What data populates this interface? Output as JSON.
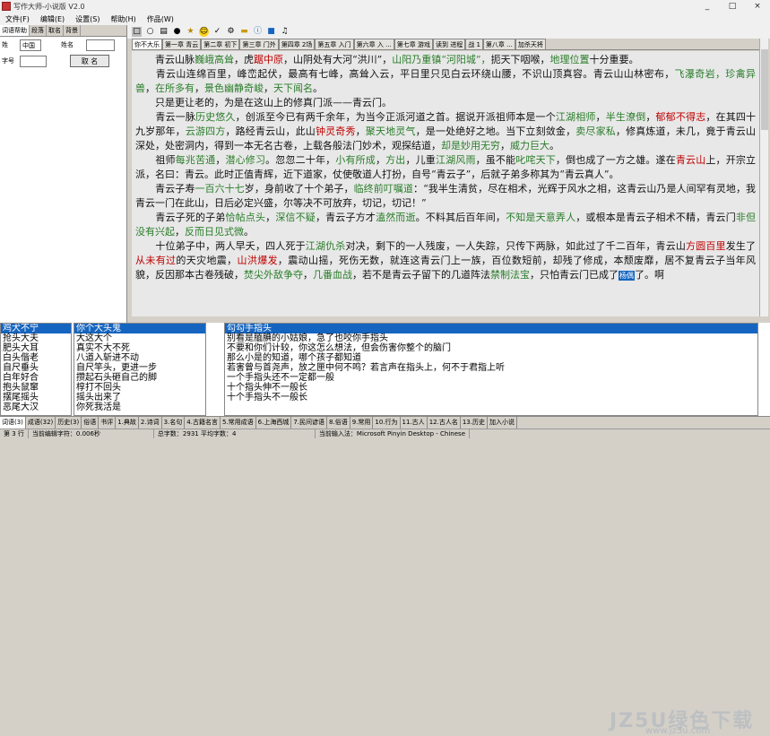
{
  "window": {
    "title": "写作大师-小说版 V2.0",
    "controls": [
      "_",
      "□",
      "×"
    ]
  },
  "menu": [
    "文件(F)",
    "编辑(E)",
    "设置(S)",
    "帮助(H)",
    "作品(W)"
  ],
  "left_panel": {
    "tabs": [
      "词语帮助",
      "段落",
      "取名",
      "背景"
    ],
    "row1": {
      "label": "姓",
      "field1": "中国",
      "label2": "姓名",
      "field2": ""
    },
    "row2": {
      "label": "字号",
      "field": "",
      "button": "取 名"
    }
  },
  "toolbar_icons": [
    "new-icon",
    "open-icon",
    "save-icon",
    "find-icon",
    "star-icon",
    "smile-icon",
    "check-icon",
    "settings-icon",
    "folder-icon",
    "info-icon",
    "stop-icon",
    "sound-icon"
  ],
  "doc_tabs": [
    "你不大乐",
    "第一章 青云",
    "第二章 初下",
    "第三章 门外",
    "第四章 2场",
    "第五章 入门",
    "第六章 入 ...",
    "第七章 游戏",
    "读到 进程",
    "战 1",
    "第八章 ...",
    "加杀天将"
  ],
  "paragraphs": [
    [
      {
        "t": "　　青云山脉"
      },
      {
        "t": "巍峨高耸",
        "c": "g"
      },
      {
        "t": "，虎"
      },
      {
        "t": "踞中原",
        "c": "r"
      },
      {
        "t": "，山阴处有大河“洪川”，"
      },
      {
        "t": "山阳乃重镇“河阳城”，",
        "c": "g"
      },
      {
        "t": "扼天下咽喉，"
      },
      {
        "t": "地理位置",
        "c": "g"
      },
      {
        "t": "十分重要。"
      }
    ],
    [
      {
        "t": "　　青云山连绵百里，峰峦起伏，最高有七峰，高耸入云，平日里只见白云环绕山腰，不识山顶真容。青云山山林密布，"
      },
      {
        "t": "飞瀑奇岩，珍禽异兽",
        "c": "g"
      },
      {
        "t": "，"
      },
      {
        "t": "在所多有",
        "c": "g"
      },
      {
        "t": "，"
      },
      {
        "t": "景色幽静奇峻",
        "c": "g"
      },
      {
        "t": "，"
      },
      {
        "t": "天下闻名",
        "c": "g"
      },
      {
        "t": "。"
      }
    ],
    [
      {
        "t": "　　只是更让老的，为是在这山上的修真门派——青云门。"
      }
    ],
    [
      {
        "t": "　　青云一脉"
      },
      {
        "t": "历史悠久",
        "c": "g"
      },
      {
        "t": "，创派至今已有两千余年，为当今正派河道之首。据说开派祖师本是一个"
      },
      {
        "t": "江湖相师",
        "c": "g"
      },
      {
        "t": "，"
      },
      {
        "t": "半生潦倒",
        "c": "g"
      },
      {
        "t": "，"
      },
      {
        "t": "郁郁不得志",
        "c": "r"
      },
      {
        "t": "，在其四十九岁那年，"
      },
      {
        "t": "云游四方",
        "c": "g"
      },
      {
        "t": "，路经青云山，此山"
      },
      {
        "t": "钟灵奇秀",
        "c": "r"
      },
      {
        "t": "，"
      },
      {
        "t": "聚天地灵气",
        "c": "g"
      },
      {
        "t": "，是一处绝好之地。当下立刻敛金，"
      },
      {
        "t": "卖尽家私",
        "c": "g"
      },
      {
        "t": "，修真炼道，未几，竟于青云山深处，处密洞内，得到一本无名古卷，上载各般法门妙术，观探结道，"
      },
      {
        "t": "却是妙用无穷",
        "c": "g"
      },
      {
        "t": "，"
      },
      {
        "t": "威力巨大",
        "c": "g"
      },
      {
        "t": "。"
      }
    ],
    [
      {
        "t": "　　祖师"
      },
      {
        "t": "每兆苦通",
        "c": "g"
      },
      {
        "t": "，"
      },
      {
        "t": "潜心修习",
        "c": "g"
      },
      {
        "t": "。忽忽二十年，"
      },
      {
        "t": "小有所成",
        "c": "g"
      },
      {
        "t": "，"
      },
      {
        "t": "方出",
        "c": "g"
      },
      {
        "t": "，儿重"
      },
      {
        "t": "江湖风雨",
        "c": "g"
      },
      {
        "t": "，虽不能"
      },
      {
        "t": "叱咤天下",
        "c": "g"
      },
      {
        "t": "，倒也成了一方之雄。遂在"
      },
      {
        "t": "青云山",
        "c": "r"
      },
      {
        "t": "上，开宗立派，名曰：青云。此时正值青辉，近下道家，仗使敬道人打扮，自号“青云子”，后就子弟多称其为“青云真人”。"
      }
    ],
    [
      {
        "t": "　　青云子寿"
      },
      {
        "t": "一百六十七",
        "c": "g"
      },
      {
        "t": "岁，身前收了十个弟子，"
      },
      {
        "t": "临终前叮嘱道",
        "c": "g"
      },
      {
        "t": "：“我半生清贫，尽在相术，光辉于风水之相，这青云山乃是人间罕有灵地，我青云一门在此山，日后必定兴盛，尔等决不可放弃，切记，切记！”"
      }
    ],
    [
      {
        "t": "　　青云子死的子弟"
      },
      {
        "t": "恰帖点头",
        "c": "g"
      },
      {
        "t": "，"
      },
      {
        "t": "深信不疑",
        "c": "g"
      },
      {
        "t": "，青云子方才"
      },
      {
        "t": "溘然而逝",
        "c": "g"
      },
      {
        "t": "。不料其后百年间，"
      },
      {
        "t": "不知是天意弄人",
        "c": "g"
      },
      {
        "t": "，或根本是青云子相术不精，青云门"
      },
      {
        "t": "非但没有兴起",
        "c": "g"
      },
      {
        "t": "，"
      },
      {
        "t": "反而日见式微",
        "c": "g"
      },
      {
        "t": "。"
      }
    ],
    [
      {
        "t": "　　十位弟子中，两人早夭，四人死于"
      },
      {
        "t": "江湖仇杀",
        "c": "g"
      },
      {
        "t": "对决，剩下的一人残废，一人失踪，只传下两脉，如此过了千二百年，青云山"
      },
      {
        "t": "方圆百里",
        "c": "r"
      },
      {
        "t": "发生了"
      },
      {
        "t": "从未有过",
        "c": "r"
      },
      {
        "t": "的天灾地震，"
      },
      {
        "t": "山洪爆发",
        "c": "r"
      },
      {
        "t": "，震动山摇，死伤无数，就连这青云门上一族，百位数短前，却残了修成，本颓废靡，居不复青云子当年风貌，反因那本古卷残破，"
      },
      {
        "t": "焚尖外敌争夺",
        "c": "g"
      },
      {
        "t": "，"
      },
      {
        "t": "几番血战",
        "c": "g"
      },
      {
        "t": "，若不是青云子留下的几道阵法"
      },
      {
        "t": "禁制法宝",
        "c": "g"
      },
      {
        "t": "，只怕青云门已成了"
      },
      {
        "t": "杨偶",
        "c": "cur"
      },
      {
        "t": "了。啊"
      }
    ]
  ],
  "list1": [
    "鸡犬不宁",
    "抢头大夫",
    "肥头大耳",
    "白头偕老",
    "自尺垂头",
    "白年好合",
    "抱头鼠窜",
    "摆尾摇头",
    "恶尾大汉"
  ],
  "list2": [
    "你个大头鬼",
    "大这大个",
    "真实不大不死",
    "八道入斩进不动",
    "自尺竿头，更进一步",
    "攒起石头砸自己的脚",
    "椁打不回头",
    "摇头出来了",
    "你死我活是"
  ],
  "list3": [
    "勾勾手指头",
    "别看是腼腆的小姑娘，急了也咬你手指头",
    "不要和你们计较，你这怎么想法，但会伤害你整个的脑门",
    "那么小是的知道，哪个孩子都知道",
    "若害曾与首尧声，放之匣中何不鸣？若言声在指头上，何不于君指上听",
    "一个手指头还不一定都一般",
    "十个指头伸不一般长",
    "十个手指头不一般长"
  ],
  "bottom_tabs": [
    "词语(3)",
    "成语(32)",
    "历史(3)",
    "俗语",
    "书评",
    "1.典故",
    "2.诗词",
    "3.名句",
    "4.古籍名言",
    "5.常用成语",
    "6.上海西城",
    "7.民间谚语",
    "8.俗语",
    "9.常用",
    "10.行为",
    "11.古人",
    "12.古人名",
    "13.历史",
    "加入小说"
  ],
  "status": [
    "第 3 行",
    "当前编辑字符：0.006秒",
    "总字数：2931 平均字数：4",
    "当前输入法：Microsoft Pinyin Desktop - Chinese"
  ],
  "watermark": {
    "main": "JZ5U绿色下载",
    "sub": "www.jz5u.com"
  }
}
